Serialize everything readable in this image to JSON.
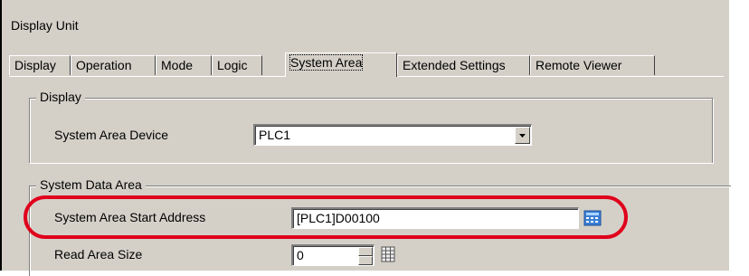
{
  "window": {
    "title": "Display Unit"
  },
  "tabs": [
    {
      "label": "Display"
    },
    {
      "label": "Operation"
    },
    {
      "label": "Mode"
    },
    {
      "label": "Logic"
    },
    {
      "label": "System Area"
    },
    {
      "label": "Extended Settings"
    },
    {
      "label": "Remote Viewer"
    }
  ],
  "active_tab": "System Area",
  "display_group": {
    "legend": "Display",
    "system_area_device_label": "System Area Device",
    "system_area_device_value": "PLC1"
  },
  "system_data_group": {
    "legend": "System Data Area",
    "start_address_label": "System Area Start Address",
    "start_address_value": "[PLC1]D00100",
    "read_area_size_label": "Read Area Size",
    "read_area_size_value": "0"
  },
  "colors": {
    "highlight": "#e0001b",
    "dialog_bg": "#d4d0c8"
  },
  "icons": {
    "dropdown": "chevron-down-icon",
    "address_input": "keypad-icon",
    "size_input": "grid-icon"
  }
}
